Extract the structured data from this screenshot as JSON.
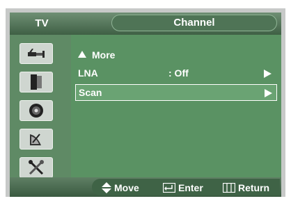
{
  "header": {
    "section_label": "TV",
    "title": "Channel"
  },
  "sidebar": {
    "items": [
      {
        "icon": "antenna-plug-icon"
      },
      {
        "icon": "speaker-icon"
      },
      {
        "icon": "disc-icon"
      },
      {
        "icon": "satellite-dish-icon"
      },
      {
        "icon": "tools-icon"
      }
    ]
  },
  "menu": {
    "more_label": "More",
    "items": [
      {
        "label": "LNA",
        "value": ": Off"
      },
      {
        "label": "Scan",
        "value": ""
      }
    ],
    "selected_index": 1
  },
  "footer": {
    "move_label": "Move",
    "enter_label": "Enter",
    "return_label": "Return"
  },
  "colors": {
    "panel": "#77a77d",
    "content": "#5a9263",
    "text": "#ffffff"
  }
}
